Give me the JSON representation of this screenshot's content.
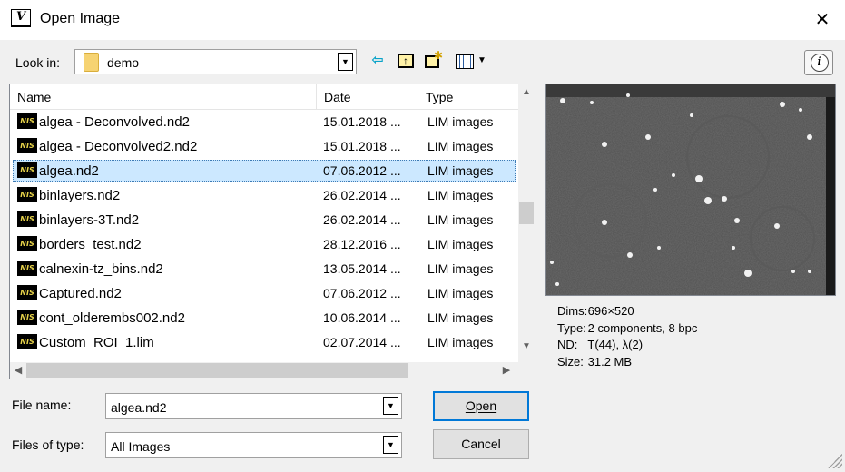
{
  "window": {
    "app_icon": "V",
    "title": "Open Image",
    "close_glyph": "✕"
  },
  "toolbar": {
    "look_in_label": "Look in:",
    "look_in_value": "demo",
    "icons": [
      "back-arrow-icon",
      "up-folder-icon",
      "new-folder-icon",
      "view-menu-icon"
    ],
    "info_glyph": "i"
  },
  "file_list": {
    "columns": [
      "Name",
      "Date",
      "Type"
    ],
    "rows": [
      {
        "name": "algea - Deconvolved.nd2",
        "date": "15.01.2018 ...",
        "type": "LIM images",
        "selected": false
      },
      {
        "name": "algea - Deconvolved2.nd2",
        "date": "15.01.2018 ...",
        "type": "LIM images",
        "selected": false
      },
      {
        "name": "algea.nd2",
        "date": "07.06.2012 ...",
        "type": "LIM images",
        "selected": true
      },
      {
        "name": "binlayers.nd2",
        "date": "26.02.2014 ...",
        "type": "LIM images",
        "selected": false
      },
      {
        "name": "binlayers-3T.nd2",
        "date": "26.02.2014 ...",
        "type": "LIM images",
        "selected": false
      },
      {
        "name": "borders_test.nd2",
        "date": "28.12.2016 ...",
        "type": "LIM images",
        "selected": false
      },
      {
        "name": "calnexin-tz_bins.nd2",
        "date": "13.05.2014 ...",
        "type": "LIM images",
        "selected": false
      },
      {
        "name": "Captured.nd2",
        "date": "07.06.2012 ...",
        "type": "LIM images",
        "selected": false
      },
      {
        "name": "cont_olderembs002.nd2",
        "date": "10.06.2014 ...",
        "type": "LIM images",
        "selected": false
      },
      {
        "name": "Custom_ROI_1.lim",
        "date": "02.07.2014 ...",
        "type": "LIM images",
        "selected": false
      }
    ],
    "file_icon_text": "NIS"
  },
  "preview_info": {
    "lines": [
      {
        "key": "Dims:",
        "value": "696×520"
      },
      {
        "key": "Type:",
        "value": "2 components, 8 bpc"
      },
      {
        "key": "ND:",
        "value": "T(44), λ(2)"
      },
      {
        "key": "Size:",
        "value": "31.2 MB"
      }
    ]
  },
  "form": {
    "file_name_label": "File name:",
    "file_name_value": "algea.nd2",
    "file_type_label": "Files of type:",
    "file_type_value": "All Images",
    "open_label": "Open",
    "cancel_label": "Cancel"
  },
  "colors": {
    "accent": "#0078d7",
    "selection": "#cce8ff"
  }
}
